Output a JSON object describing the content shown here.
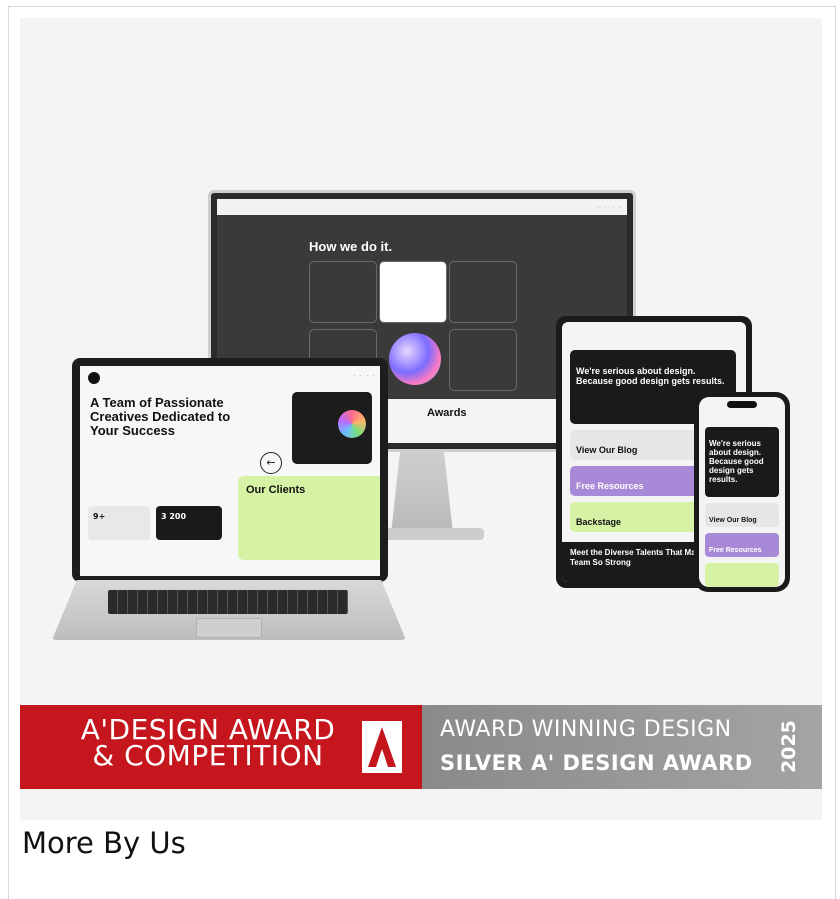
{
  "showcase": {
    "desktop": {
      "heading": "How we do it.",
      "awards_label": "Awards"
    },
    "laptop": {
      "hero_title": "A Team of Passionate Creatives Dedicated to Your Success",
      "clients_title": "Our Clients",
      "stat1": "9+",
      "stat2": "3 200",
      "arrow": "←"
    },
    "tablet": {
      "dark_title": "We're serious about design. Because good design gets results.",
      "row1": "View Our Blog",
      "row2": "Free Resources",
      "row3": "Backstage",
      "footer": "Meet the Diverse Talents That Make Our Team So Strong"
    },
    "phone": {
      "dark_title": "We're serious about design. Because good design gets results.",
      "row1": "View Our Blog",
      "row2": "Free Resources"
    }
  },
  "banner": {
    "left_line1": "A'DESIGN AWARD",
    "left_line2": "& COMPETITION",
    "right_line1": "AWARD WINNING DESIGN",
    "right_line2": "SILVER A' DESIGN AWARD",
    "year": "2025",
    "colors": {
      "red": "#c5161d",
      "gray": "#9a9a9a"
    }
  },
  "more_by_us": "More By Us"
}
